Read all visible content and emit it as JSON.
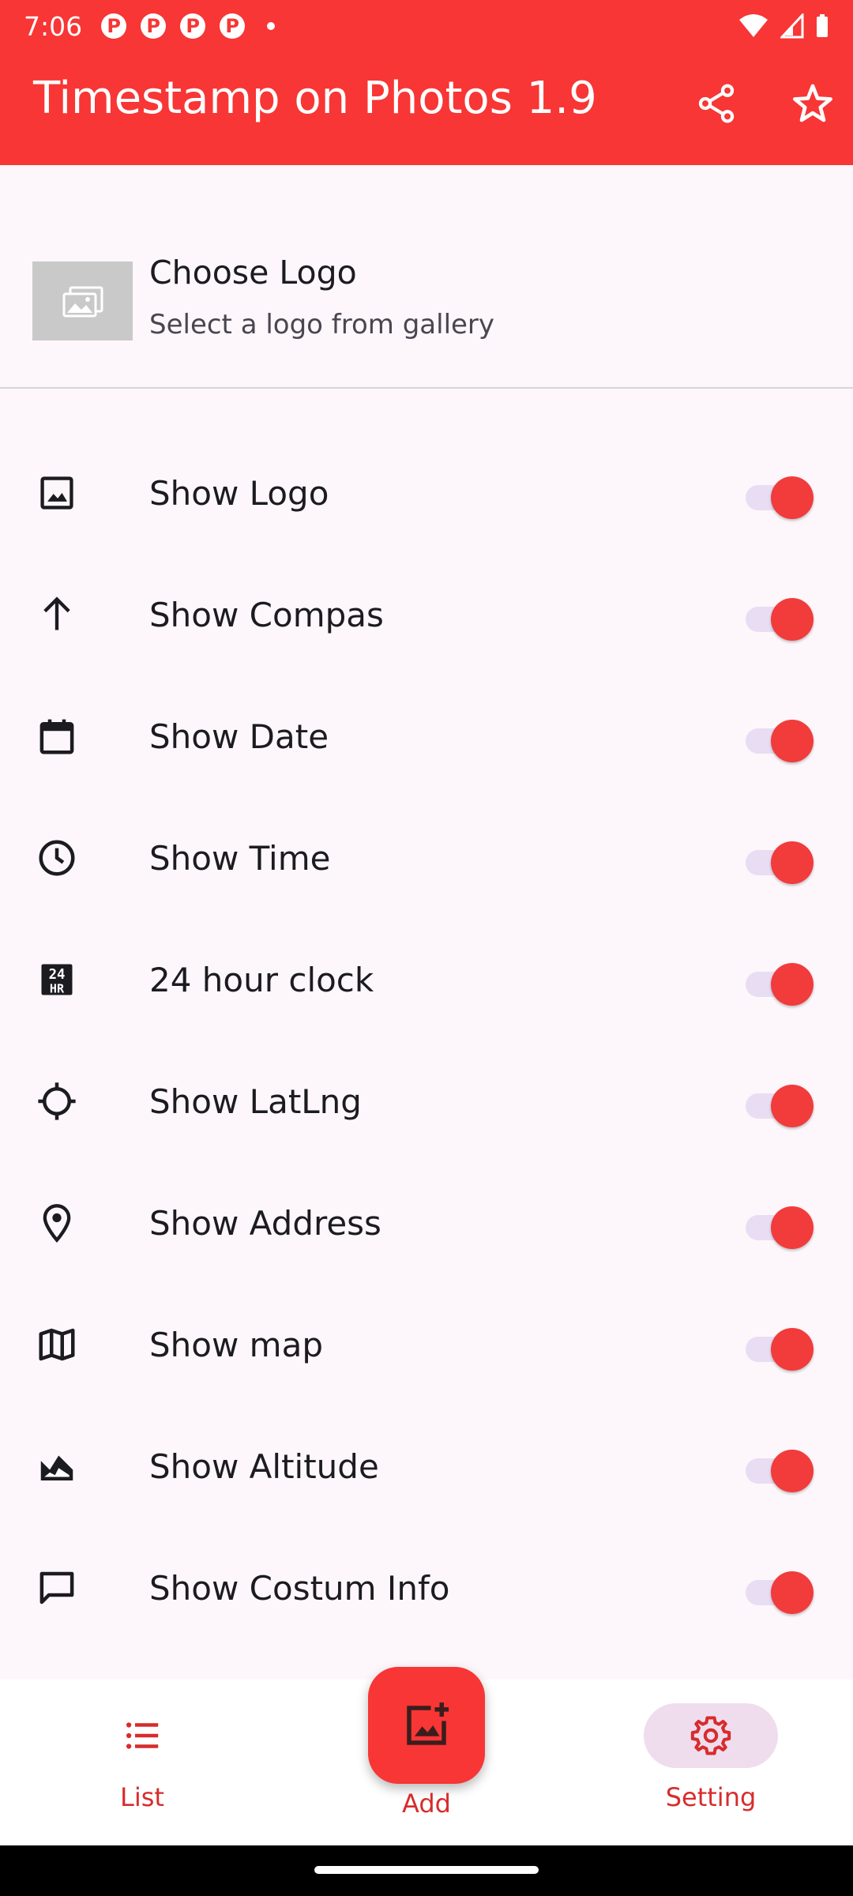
{
  "status_bar": {
    "time": "7:06",
    "notification_icons": [
      "P",
      "P",
      "P",
      "P"
    ]
  },
  "app_bar": {
    "title": "Timestamp on Photos 1.9",
    "actions": [
      "share-icon",
      "star-icon"
    ],
    "color": "#F73635"
  },
  "logo_section": {
    "title": "Choose Logo",
    "subtitle": "Select a logo from gallery"
  },
  "settings": [
    {
      "icon": "image-icon",
      "label": "Show Logo",
      "enabled": true
    },
    {
      "icon": "arrow-up-icon",
      "label": "Show Compas",
      "enabled": true
    },
    {
      "icon": "calendar-icon",
      "label": "Show Date",
      "enabled": true
    },
    {
      "icon": "clock-icon",
      "label": "Show Time",
      "enabled": true
    },
    {
      "icon": "24h-clock-icon",
      "label": "24 hour clock",
      "enabled": true
    },
    {
      "icon": "crosshair-icon",
      "label": "Show LatLng",
      "enabled": true
    },
    {
      "icon": "location-pin-icon",
      "label": "Show Address",
      "enabled": true
    },
    {
      "icon": "map-icon",
      "label": "Show map",
      "enabled": true
    },
    {
      "icon": "altitude-icon",
      "label": "Show Altitude",
      "enabled": true
    },
    {
      "icon": "chat-bubble-icon",
      "label": "Show Costum Info",
      "enabled": true
    }
  ],
  "bottom_nav": {
    "list_label": "List",
    "add_label": "Add",
    "setting_label": "Setting",
    "selected": "Setting",
    "accent": "#D72C2C"
  }
}
